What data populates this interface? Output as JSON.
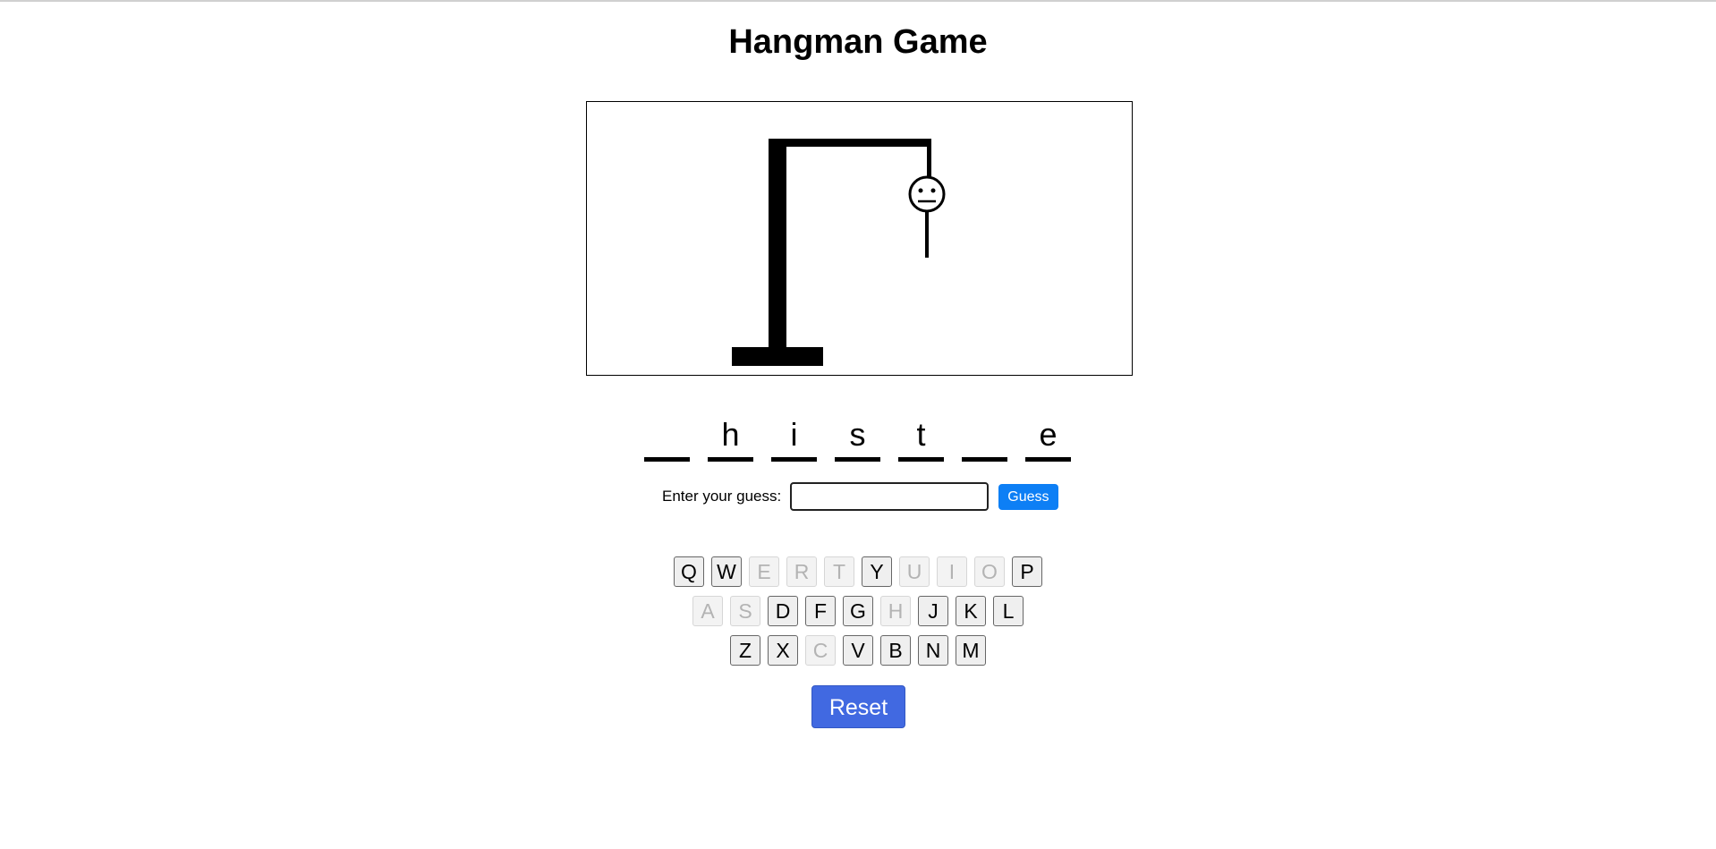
{
  "title": "Hangman Game",
  "word": {
    "slots": [
      "",
      "h",
      "i",
      "s",
      "t",
      "",
      "e"
    ]
  },
  "guess": {
    "label": "Enter your guess:",
    "value": "",
    "placeholder": "",
    "button_label": "Guess"
  },
  "keyboard": {
    "rows": [
      [
        {
          "letter": "Q",
          "used": false
        },
        {
          "letter": "W",
          "used": false
        },
        {
          "letter": "E",
          "used": true
        },
        {
          "letter": "R",
          "used": true
        },
        {
          "letter": "T",
          "used": true
        },
        {
          "letter": "Y",
          "used": false
        },
        {
          "letter": "U",
          "used": true
        },
        {
          "letter": "I",
          "used": true
        },
        {
          "letter": "O",
          "used": true
        },
        {
          "letter": "P",
          "used": false
        }
      ],
      [
        {
          "letter": "A",
          "used": true
        },
        {
          "letter": "S",
          "used": true
        },
        {
          "letter": "D",
          "used": false
        },
        {
          "letter": "F",
          "used": false
        },
        {
          "letter": "G",
          "used": false
        },
        {
          "letter": "H",
          "used": true
        },
        {
          "letter": "J",
          "used": false
        },
        {
          "letter": "K",
          "used": false
        },
        {
          "letter": "L",
          "used": false
        }
      ],
      [
        {
          "letter": "Z",
          "used": false
        },
        {
          "letter": "X",
          "used": false
        },
        {
          "letter": "C",
          "used": true
        },
        {
          "letter": "V",
          "used": false
        },
        {
          "letter": "B",
          "used": false
        },
        {
          "letter": "N",
          "used": false
        },
        {
          "letter": "M",
          "used": false
        }
      ]
    ]
  },
  "reset_label": "Reset",
  "hangman": {
    "parts_shown": [
      "head",
      "body"
    ]
  },
  "colors": {
    "guess_button": "#0d7ff5",
    "reset_button": "#4169e1",
    "used_key_text": "#b3b3b3"
  }
}
